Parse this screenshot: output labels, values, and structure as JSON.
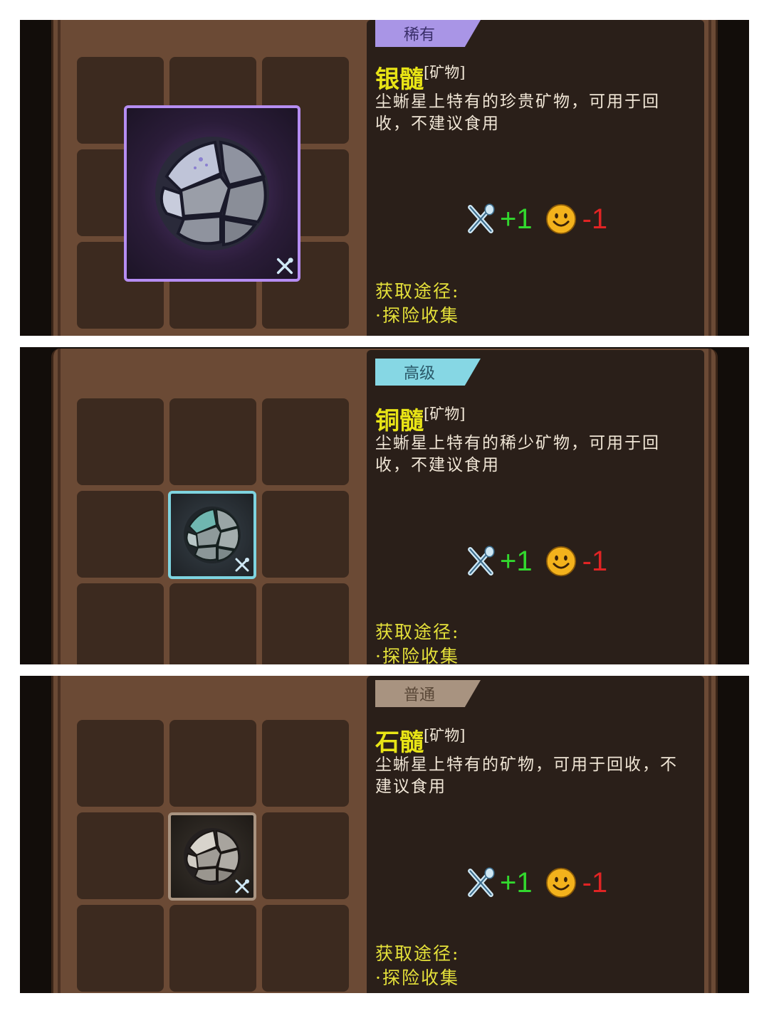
{
  "panels": [
    {
      "rarity": "稀有",
      "name": "银髓",
      "category": "[矿物]",
      "description": "尘蜥星上特有的珍贵矿物，可用于回收，不建议食用",
      "hunger": "+1",
      "mood": "-1",
      "acquire_label": "获取途径:",
      "acquire_method": "·探险收集"
    },
    {
      "rarity": "高级",
      "name": "铜髓",
      "category": "[矿物]",
      "description": "尘蜥星上特有的稀少矿物，可用于回收，不建议食用",
      "hunger": "+1",
      "mood": "-1",
      "acquire_label": "获取途径:",
      "acquire_method": "·探险收集"
    },
    {
      "rarity": "普通",
      "name": "石髓",
      "category": "[矿物]",
      "description": "尘蜥星上特有的矿物，可用于回收，不建议食用",
      "hunger": "+1",
      "mood": "-1",
      "acquire_label": "获取途径:",
      "acquire_method": "·探险收集"
    }
  ],
  "colors": {
    "rare_tag": "#a995e6",
    "advanced_tag": "#86d7e4",
    "common_tag": "#a89380",
    "name_yellow": "#e8e416",
    "plus_green": "#32d82e",
    "minus_red": "#e02424"
  },
  "icons": {
    "item": "ore-ball-icon",
    "hunger": "fork-spoon-icon",
    "mood": "smiley-face-icon"
  }
}
